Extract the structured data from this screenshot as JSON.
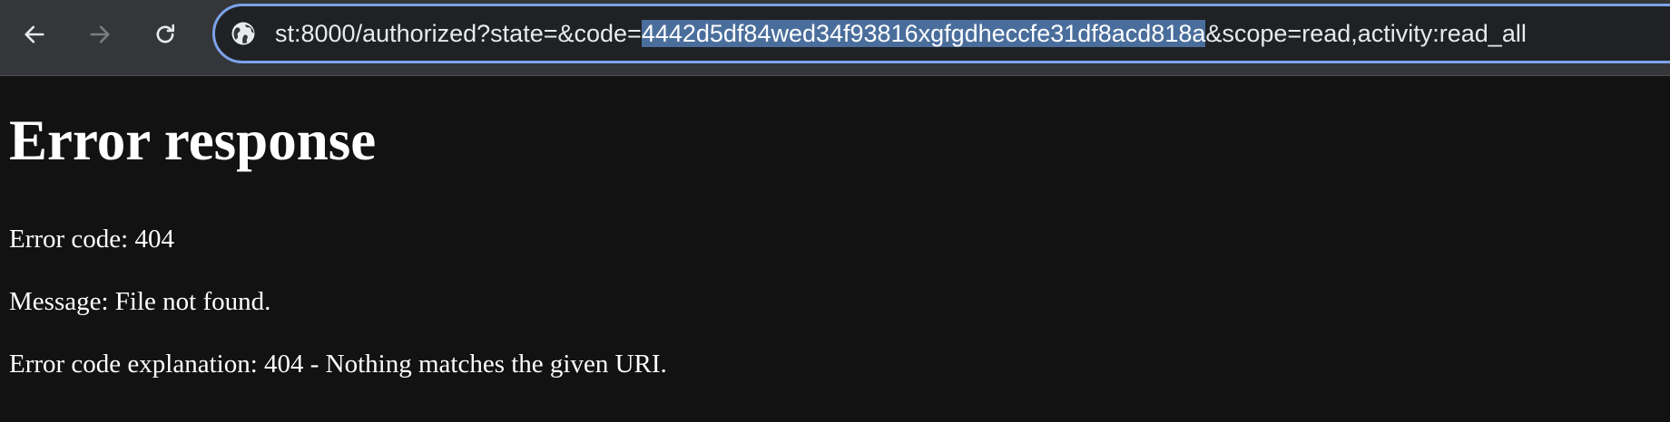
{
  "toolbar": {
    "back_icon": "arrow-left-icon",
    "forward_icon": "arrow-right-icon",
    "reload_icon": "reload-icon",
    "site_info_icon": "globe-icon",
    "url_prefix": "st:8000/authorized?state=&code=",
    "url_selected": "4442d5df84wed34f93816xgfgdheccfe31df8acd818a",
    "url_suffix": "&scope=read,activity:read_all"
  },
  "page": {
    "title": "Error response",
    "error_code": "Error code: 404",
    "message": "Message: File not found.",
    "explanation": "Error code explanation: 404 - Nothing matches the given URI."
  },
  "colors": {
    "toolbar_bg": "#35363a",
    "omnibox_border": "#7ca2e8",
    "selection_bg": "#4a6e9c",
    "page_bg": "#121212",
    "text": "#ffffff"
  }
}
